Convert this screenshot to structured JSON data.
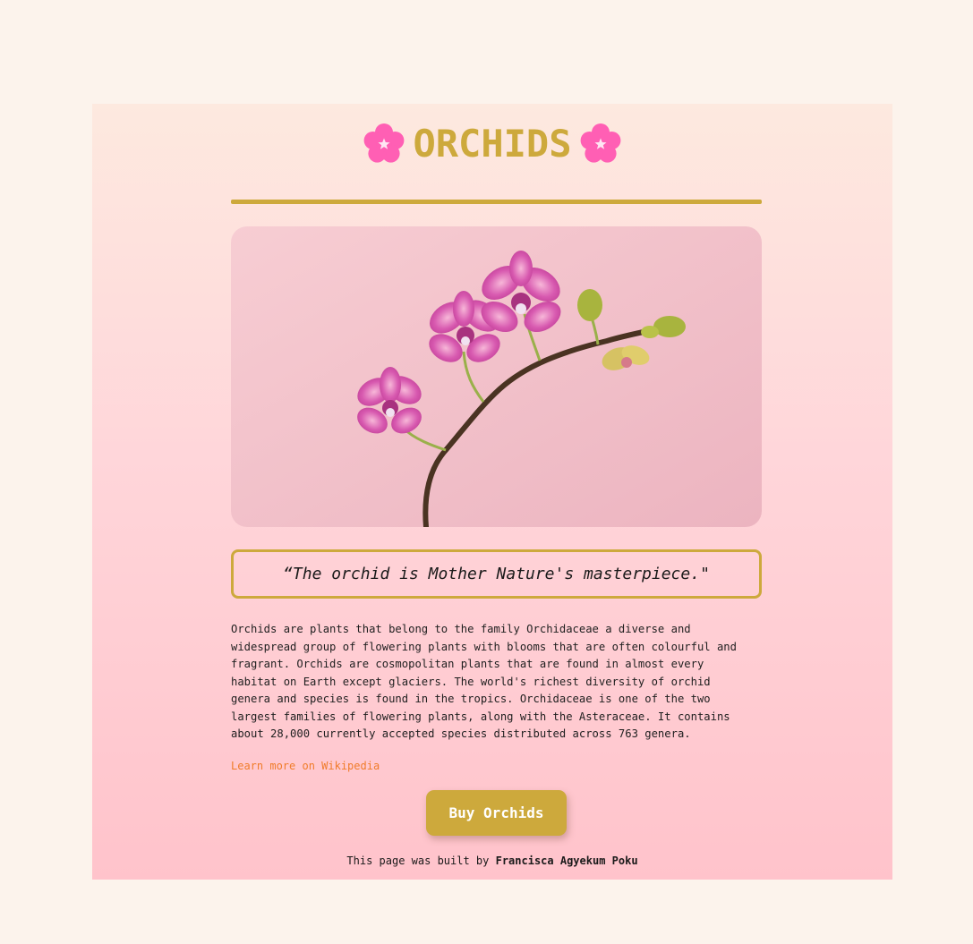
{
  "header": {
    "title": "ORCHIDS",
    "icon_left": "pink-blossom-icon",
    "icon_right": "pink-blossom-icon",
    "title_color": "#cda93c",
    "icon_color": "#ff5fb4"
  },
  "hero_image": {
    "subject": "pink-orchid-photo"
  },
  "quote": {
    "text": "“The orchid is Mother Nature's masterpiece.\""
  },
  "description": {
    "text": "Orchids are plants that belong to the family Orchidaceae a diverse and widespread group of flowering plants with blooms that are often colourful and fragrant. Orchids are cosmopolitan plants that are found in almost every habitat on Earth except glaciers. The world's richest diversity of orchid genera and species is found in the tropics. Orchidaceae is one of the two largest families of flowering plants, along with the Asteraceae. It contains about 28,000 currently accepted species distributed across 763 genera."
  },
  "link": {
    "label": "Learn more on Wikipedia",
    "color": "#f07c2a"
  },
  "cta": {
    "label": "Buy Orchids",
    "color": "#cda93c"
  },
  "footer": {
    "prefix": "This page was built by",
    "author": "Francisca Agyekum Poku"
  },
  "colors": {
    "page_bg": "#fcf3ec",
    "accent": "#cda93c"
  }
}
